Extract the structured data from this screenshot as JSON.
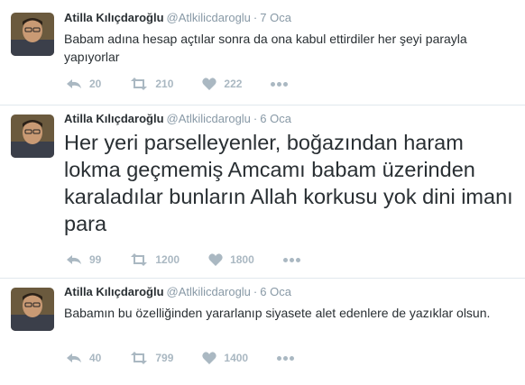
{
  "colors": {
    "name": "#292f33",
    "meta": "#8899a6",
    "action": "#aab8c2",
    "divider": "#e1e8ed"
  },
  "icons": {
    "reply": "reply-icon",
    "retweet": "retweet-icon",
    "like": "heart-icon",
    "more": "more-dots-icon"
  },
  "tweets": [
    {
      "name": "Atilla Kılıçdaroğlu",
      "handle": "@Atlkilicdaroglu",
      "separator": "·",
      "time": "7 Oca",
      "text": "Babam adına hesap açtılar sonra da ona kabul ettirdiler her şeyi parayla yapıyorlar",
      "replies": "20",
      "retweets": "210",
      "likes": "222"
    },
    {
      "name": "Atilla Kılıçdaroğlu",
      "handle": "@Atlkilicdaroglu",
      "separator": "·",
      "time": "6 Oca",
      "text": "Her yeri parselleyenler, boğazından haram lokma geçmemiş Amcamı babam üzerinden karaladılar bunların Allah korkusu yok dini imanı para",
      "replies": "99",
      "retweets": "1200",
      "likes": "1800"
    },
    {
      "name": "Atilla Kılıçdaroğlu",
      "handle": "@Atlkilicdaroglu",
      "separator": "·",
      "time": "6 Oca",
      "text": "Babamın bu özelliğinden yararlanıp siyasete alet edenlere de yazıklar olsun.",
      "replies": "40",
      "retweets": "799",
      "likes": "1400"
    }
  ]
}
